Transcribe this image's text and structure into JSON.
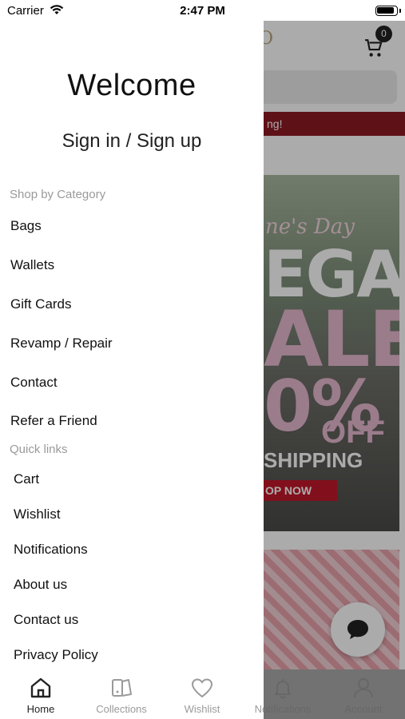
{
  "status": {
    "carrier": "Carrier",
    "time": "2:47 PM"
  },
  "drawer": {
    "welcome": "Welcome",
    "signin": "Sign in / Sign up",
    "category_heading": "Shop by Category",
    "categories": [
      "Bags",
      "Wallets",
      "Gift Cards",
      "Revamp / Repair",
      "Contact",
      "Refer a Friend"
    ],
    "quick_links_heading": "Quick links",
    "quick_links": [
      "Cart",
      "Wishlist",
      "Notifications",
      "About us",
      "Contact us",
      "Privacy Policy"
    ]
  },
  "background": {
    "cart_count": "0",
    "banner_text": "ng!",
    "promo": {
      "script": "ne's Day",
      "line1": "EGA",
      "line2": "ALE",
      "line3": "0%",
      "off": "OFF",
      "shipping": "SHIPPING",
      "button": "OP NOW"
    }
  },
  "tabs": [
    {
      "label": "Home",
      "icon": "home-icon",
      "active": true
    },
    {
      "label": "Collections",
      "icon": "collections-icon",
      "active": false
    },
    {
      "label": "Wishlist",
      "icon": "heart-icon",
      "active": false
    },
    {
      "label": "Notifications",
      "icon": "bell-icon",
      "active": false
    },
    {
      "label": "Account",
      "icon": "person-icon",
      "active": false
    }
  ],
  "colors": {
    "banner": "#8e1a24",
    "promo_pink": "#e6b9d0",
    "section_gray": "#9a9a9a"
  }
}
